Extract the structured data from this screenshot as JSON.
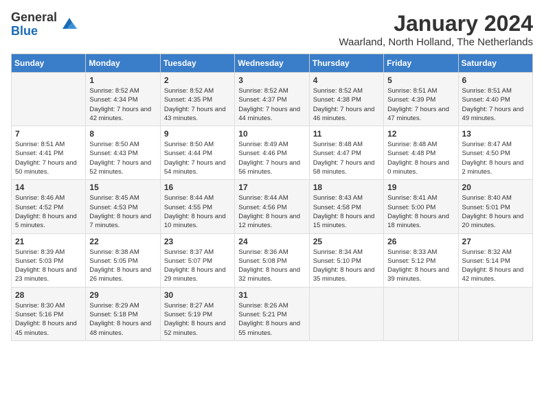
{
  "header": {
    "logo_general": "General",
    "logo_blue": "Blue",
    "month": "January 2024",
    "location": "Waarland, North Holland, The Netherlands"
  },
  "days_of_week": [
    "Sunday",
    "Monday",
    "Tuesday",
    "Wednesday",
    "Thursday",
    "Friday",
    "Saturday"
  ],
  "weeks": [
    [
      {
        "day": "",
        "sunrise": "",
        "sunset": "",
        "daylight": ""
      },
      {
        "day": "1",
        "sunrise": "Sunrise: 8:52 AM",
        "sunset": "Sunset: 4:34 PM",
        "daylight": "Daylight: 7 hours and 42 minutes."
      },
      {
        "day": "2",
        "sunrise": "Sunrise: 8:52 AM",
        "sunset": "Sunset: 4:35 PM",
        "daylight": "Daylight: 7 hours and 43 minutes."
      },
      {
        "day": "3",
        "sunrise": "Sunrise: 8:52 AM",
        "sunset": "Sunset: 4:37 PM",
        "daylight": "Daylight: 7 hours and 44 minutes."
      },
      {
        "day": "4",
        "sunrise": "Sunrise: 8:52 AM",
        "sunset": "Sunset: 4:38 PM",
        "daylight": "Daylight: 7 hours and 46 minutes."
      },
      {
        "day": "5",
        "sunrise": "Sunrise: 8:51 AM",
        "sunset": "Sunset: 4:39 PM",
        "daylight": "Daylight: 7 hours and 47 minutes."
      },
      {
        "day": "6",
        "sunrise": "Sunrise: 8:51 AM",
        "sunset": "Sunset: 4:40 PM",
        "daylight": "Daylight: 7 hours and 49 minutes."
      }
    ],
    [
      {
        "day": "7",
        "sunrise": "Sunrise: 8:51 AM",
        "sunset": "Sunset: 4:41 PM",
        "daylight": "Daylight: 7 hours and 50 minutes."
      },
      {
        "day": "8",
        "sunrise": "Sunrise: 8:50 AM",
        "sunset": "Sunset: 4:43 PM",
        "daylight": "Daylight: 7 hours and 52 minutes."
      },
      {
        "day": "9",
        "sunrise": "Sunrise: 8:50 AM",
        "sunset": "Sunset: 4:44 PM",
        "daylight": "Daylight: 7 hours and 54 minutes."
      },
      {
        "day": "10",
        "sunrise": "Sunrise: 8:49 AM",
        "sunset": "Sunset: 4:46 PM",
        "daylight": "Daylight: 7 hours and 56 minutes."
      },
      {
        "day": "11",
        "sunrise": "Sunrise: 8:48 AM",
        "sunset": "Sunset: 4:47 PM",
        "daylight": "Daylight: 7 hours and 58 minutes."
      },
      {
        "day": "12",
        "sunrise": "Sunrise: 8:48 AM",
        "sunset": "Sunset: 4:48 PM",
        "daylight": "Daylight: 8 hours and 0 minutes."
      },
      {
        "day": "13",
        "sunrise": "Sunrise: 8:47 AM",
        "sunset": "Sunset: 4:50 PM",
        "daylight": "Daylight: 8 hours and 2 minutes."
      }
    ],
    [
      {
        "day": "14",
        "sunrise": "Sunrise: 8:46 AM",
        "sunset": "Sunset: 4:52 PM",
        "daylight": "Daylight: 8 hours and 5 minutes."
      },
      {
        "day": "15",
        "sunrise": "Sunrise: 8:45 AM",
        "sunset": "Sunset: 4:53 PM",
        "daylight": "Daylight: 8 hours and 7 minutes."
      },
      {
        "day": "16",
        "sunrise": "Sunrise: 8:44 AM",
        "sunset": "Sunset: 4:55 PM",
        "daylight": "Daylight: 8 hours and 10 minutes."
      },
      {
        "day": "17",
        "sunrise": "Sunrise: 8:44 AM",
        "sunset": "Sunset: 4:56 PM",
        "daylight": "Daylight: 8 hours and 12 minutes."
      },
      {
        "day": "18",
        "sunrise": "Sunrise: 8:43 AM",
        "sunset": "Sunset: 4:58 PM",
        "daylight": "Daylight: 8 hours and 15 minutes."
      },
      {
        "day": "19",
        "sunrise": "Sunrise: 8:41 AM",
        "sunset": "Sunset: 5:00 PM",
        "daylight": "Daylight: 8 hours and 18 minutes."
      },
      {
        "day": "20",
        "sunrise": "Sunrise: 8:40 AM",
        "sunset": "Sunset: 5:01 PM",
        "daylight": "Daylight: 8 hours and 20 minutes."
      }
    ],
    [
      {
        "day": "21",
        "sunrise": "Sunrise: 8:39 AM",
        "sunset": "Sunset: 5:03 PM",
        "daylight": "Daylight: 8 hours and 23 minutes."
      },
      {
        "day": "22",
        "sunrise": "Sunrise: 8:38 AM",
        "sunset": "Sunset: 5:05 PM",
        "daylight": "Daylight: 8 hours and 26 minutes."
      },
      {
        "day": "23",
        "sunrise": "Sunrise: 8:37 AM",
        "sunset": "Sunset: 5:07 PM",
        "daylight": "Daylight: 8 hours and 29 minutes."
      },
      {
        "day": "24",
        "sunrise": "Sunrise: 8:36 AM",
        "sunset": "Sunset: 5:08 PM",
        "daylight": "Daylight: 8 hours and 32 minutes."
      },
      {
        "day": "25",
        "sunrise": "Sunrise: 8:34 AM",
        "sunset": "Sunset: 5:10 PM",
        "daylight": "Daylight: 8 hours and 35 minutes."
      },
      {
        "day": "26",
        "sunrise": "Sunrise: 8:33 AM",
        "sunset": "Sunset: 5:12 PM",
        "daylight": "Daylight: 8 hours and 39 minutes."
      },
      {
        "day": "27",
        "sunrise": "Sunrise: 8:32 AM",
        "sunset": "Sunset: 5:14 PM",
        "daylight": "Daylight: 8 hours and 42 minutes."
      }
    ],
    [
      {
        "day": "28",
        "sunrise": "Sunrise: 8:30 AM",
        "sunset": "Sunset: 5:16 PM",
        "daylight": "Daylight: 8 hours and 45 minutes."
      },
      {
        "day": "29",
        "sunrise": "Sunrise: 8:29 AM",
        "sunset": "Sunset: 5:18 PM",
        "daylight": "Daylight: 8 hours and 48 minutes."
      },
      {
        "day": "30",
        "sunrise": "Sunrise: 8:27 AM",
        "sunset": "Sunset: 5:19 PM",
        "daylight": "Daylight: 8 hours and 52 minutes."
      },
      {
        "day": "31",
        "sunrise": "Sunrise: 8:26 AM",
        "sunset": "Sunset: 5:21 PM",
        "daylight": "Daylight: 8 hours and 55 minutes."
      },
      {
        "day": "",
        "sunrise": "",
        "sunset": "",
        "daylight": ""
      },
      {
        "day": "",
        "sunrise": "",
        "sunset": "",
        "daylight": ""
      },
      {
        "day": "",
        "sunrise": "",
        "sunset": "",
        "daylight": ""
      }
    ]
  ]
}
